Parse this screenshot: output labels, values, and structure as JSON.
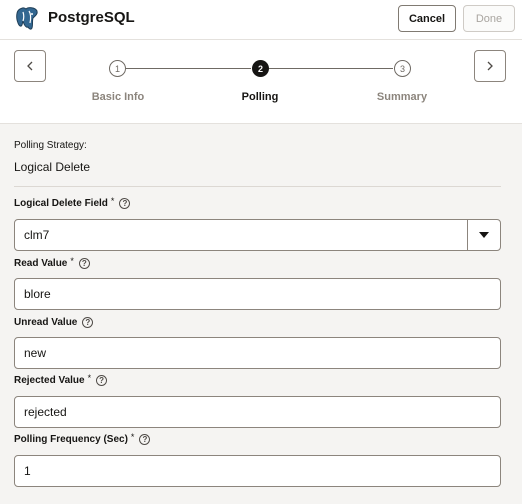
{
  "header": {
    "title": "PostgreSQL",
    "cancel_label": "Cancel",
    "done_label": "Done"
  },
  "train": {
    "steps": [
      {
        "number": "1",
        "label": "Basic Info",
        "state": "inactive"
      },
      {
        "number": "2",
        "label": "Polling",
        "state": "active"
      },
      {
        "number": "3",
        "label": "Summary",
        "state": "inactive"
      }
    ]
  },
  "form": {
    "strategy_label": "Polling Strategy:",
    "strategy_value": "Logical Delete",
    "logical_delete_field": {
      "label": "Logical Delete Field",
      "required": "*",
      "value": "clm7"
    },
    "read_value": {
      "label": "Read Value",
      "required": "*",
      "value": "blore"
    },
    "unread_value": {
      "label": "Unread Value",
      "value": "new"
    },
    "rejected_value": {
      "label": "Rejected Value",
      "required": "*",
      "value": "rejected"
    },
    "polling_frequency": {
      "label": "Polling Frequency (Sec)",
      "required": "*",
      "value": "1"
    }
  },
  "icons": {
    "logo": "postgresql-elephant-icon",
    "prev": "chevron-left-icon",
    "next": "chevron-right-icon",
    "help": "help-circle-icon",
    "dropdown": "caret-down-icon"
  },
  "colors": {
    "logo_blue": "#336791",
    "active_step": "#161513"
  }
}
